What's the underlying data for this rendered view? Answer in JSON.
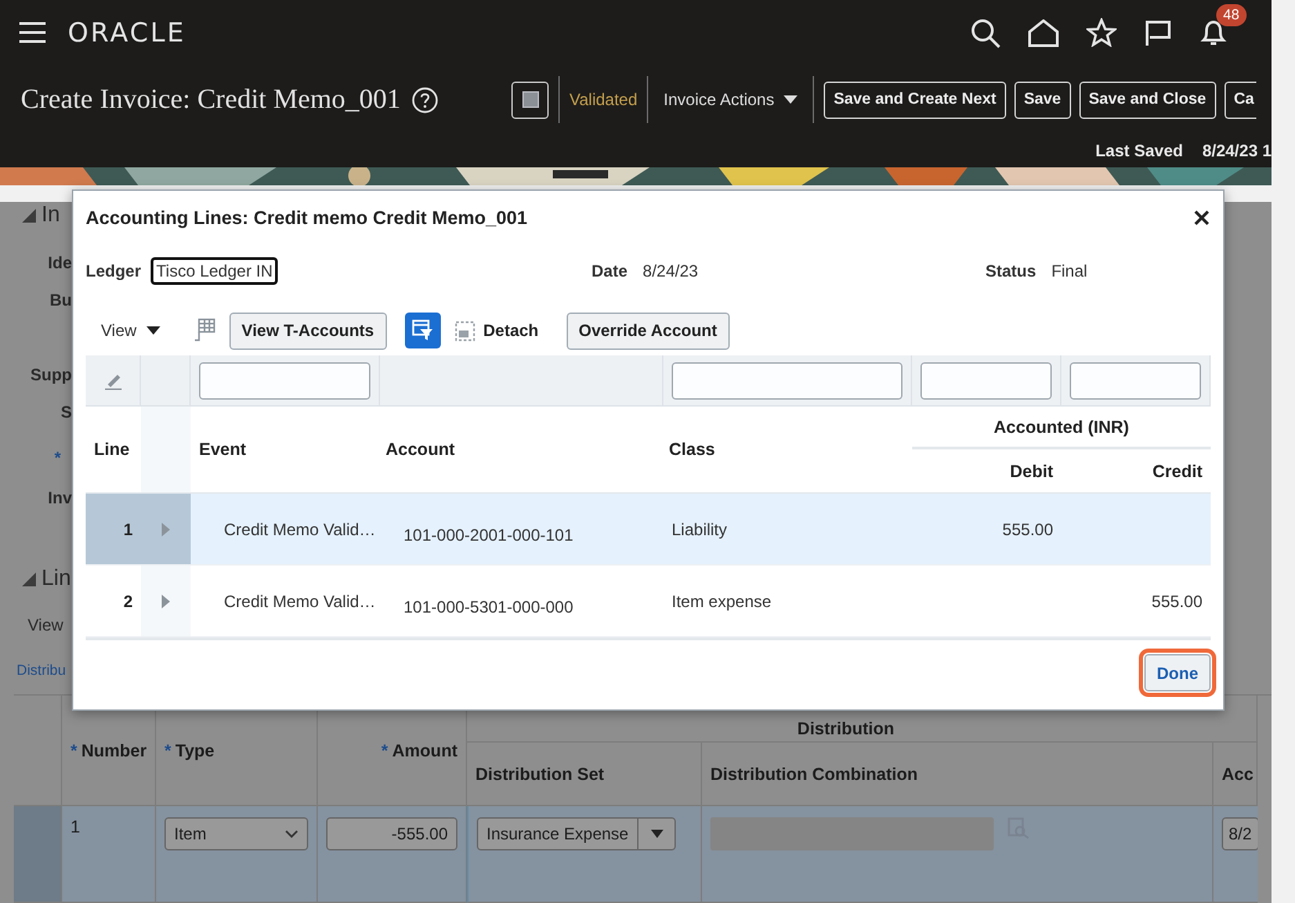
{
  "header": {
    "logo": "ORACLE",
    "notification_count": "48"
  },
  "page": {
    "title": "Create Invoice: Credit Memo_001",
    "status": "Validated",
    "actions_menu": "Invoice Actions",
    "buttons": [
      "Save and Create Next",
      "Save",
      "Save and Close",
      "Ca"
    ],
    "last_saved_label": "Last Saved",
    "last_saved_value": "8/24/23 1"
  },
  "background": {
    "fragments": [
      {
        "kind": "heading",
        "text": "In"
      },
      {
        "kind": "label",
        "text": "Ide"
      },
      {
        "kind": "label",
        "text": "Bu"
      },
      {
        "kind": "label",
        "text": "Supp"
      },
      {
        "kind": "label",
        "text": "S"
      },
      {
        "kind": "required",
        "text": "*"
      },
      {
        "kind": "label",
        "text": "Inv"
      },
      {
        "kind": "heading",
        "text": "Lin"
      },
      {
        "kind": "menu",
        "text": "View"
      },
      {
        "kind": "tab",
        "text": "Distribu"
      }
    ],
    "table": {
      "group_header": "Distribution",
      "columns": [
        {
          "label": "Number",
          "required_mark": "*"
        },
        {
          "label": "Type",
          "required_mark": "*"
        },
        {
          "label": "Amount",
          "required_mark": "*"
        },
        {
          "label": "Distribution Set"
        },
        {
          "label": "Distribution Combination"
        },
        {
          "label": "Acc"
        }
      ],
      "rows": [
        {
          "number": "1",
          "type": "Item",
          "amount": "-555.00",
          "distribution_set": "Insurance Expense",
          "accounting_date": "8/2",
          "selected": true
        }
      ]
    }
  },
  "dialog": {
    "title": "Accounting Lines: Credit memo Credit Memo_001",
    "fields": [
      {
        "label": "Ledger",
        "value": "Tisco Ledger IN",
        "focused": true
      },
      {
        "label": "Date",
        "value": "8/24/23",
        "focused": false
      },
      {
        "label": "Status",
        "value": "Final",
        "focused": false
      }
    ],
    "toolbar": {
      "view_menu": "View",
      "items": [
        {
          "kind": "freeze"
        },
        {
          "kind": "button",
          "label": "View T-Accounts"
        },
        {
          "kind": "toggle",
          "selected": true
        },
        {
          "kind": "link",
          "label": "Detach"
        },
        {
          "kind": "button",
          "label": "Override Account"
        }
      ]
    },
    "table": {
      "group_header": "Accounted (INR)",
      "columns": [
        {
          "label": "Line"
        },
        {
          "label": "Event",
          "filter": true
        },
        {
          "label": "Account",
          "filter": false
        },
        {
          "label": "Class",
          "filter": true
        },
        {
          "label": "Debit",
          "filter": true
        },
        {
          "label": "Credit",
          "filter": true
        }
      ],
      "rows": [
        {
          "line": "1",
          "event": "Credit Memo Valid…",
          "account": "101-000-2001-000-101",
          "class": "Liability",
          "debit": "555.00",
          "selected": true
        },
        {
          "line": "2",
          "event": "Credit Memo Valid…",
          "account": "101-000-5301-000-000",
          "class": "Item expense",
          "credit": "555.00",
          "selected": false
        }
      ]
    },
    "done_button": {
      "label": "Done",
      "highlighted": true
    }
  }
}
